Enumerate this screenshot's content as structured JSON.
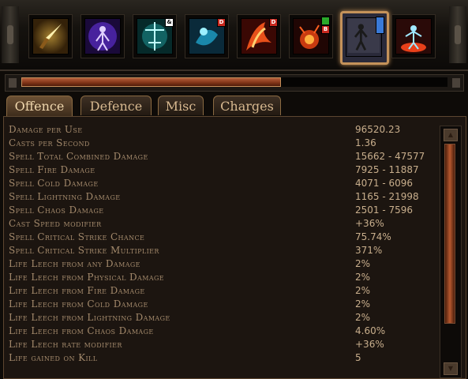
{
  "skill_bar": {
    "skills": [
      {
        "icon": "golden-dagger-icon",
        "badge": ""
      },
      {
        "icon": "purple-aura-figure-icon",
        "badge": ""
      },
      {
        "icon": "teal-spectral-sword-icon",
        "badge": "&"
      },
      {
        "icon": "blue-swirl-icon",
        "badge": "D"
      },
      {
        "icon": "fire-claw-icon",
        "badge": "D"
      },
      {
        "icon": "flame-burst-icon",
        "badge": "B"
      },
      {
        "icon": "lightning-figure-icon",
        "badge": ""
      },
      {
        "icon": "blue-fire-figure-icon",
        "badge": ""
      }
    ],
    "selected_index": 6
  },
  "progress": {
    "fraction": 0.61
  },
  "tabs": [
    {
      "label": "Offence",
      "active": true
    },
    {
      "label": "Defence",
      "active": false
    },
    {
      "label": "Misc",
      "active": false
    },
    {
      "label": "Charges",
      "active": false
    }
  ],
  "stats": [
    {
      "label": "Damage per Use",
      "value": "96520.23"
    },
    {
      "label": "Casts per Second",
      "value": "1.36"
    },
    {
      "label": "Spell Total Combined Damage",
      "value": "15662 - 47577"
    },
    {
      "label": "Spell Fire Damage",
      "value": "7925 - 11887"
    },
    {
      "label": "Spell Cold Damage",
      "value": "4071 - 6096"
    },
    {
      "label": "Spell Lightning Damage",
      "value": "1165 - 21998"
    },
    {
      "label": "Spell Chaos Damage",
      "value": "2501 - 7596"
    },
    {
      "label": "Cast Speed modifier",
      "value": "+36%"
    },
    {
      "label": "Spell Critical Strike Chance",
      "value": "75.74%"
    },
    {
      "label": "Spell Critical Strike Multiplier",
      "value": "371%"
    },
    {
      "label": "Life Leech from any Damage",
      "value": "2%"
    },
    {
      "label": "Life Leech from Physical Damage",
      "value": "2%"
    },
    {
      "label": "Life Leech from Fire Damage",
      "value": "2%"
    },
    {
      "label": "Life Leech from Cold Damage",
      "value": "2%"
    },
    {
      "label": "Life Leech from Lightning Damage",
      "value": "2%"
    },
    {
      "label": "Life Leech from Chaos Damage",
      "value": "4.60%"
    },
    {
      "label": "Life Leech rate modifier",
      "value": "+36%"
    },
    {
      "label": "Life gained on Kill",
      "value": "5"
    }
  ],
  "colors": {
    "accent_gold": "#c4925a",
    "label_text": "#a48a6c",
    "value_text": "#c8ae8c",
    "progress_fill": "#7d3216",
    "panel_bg": "#1c1510"
  }
}
